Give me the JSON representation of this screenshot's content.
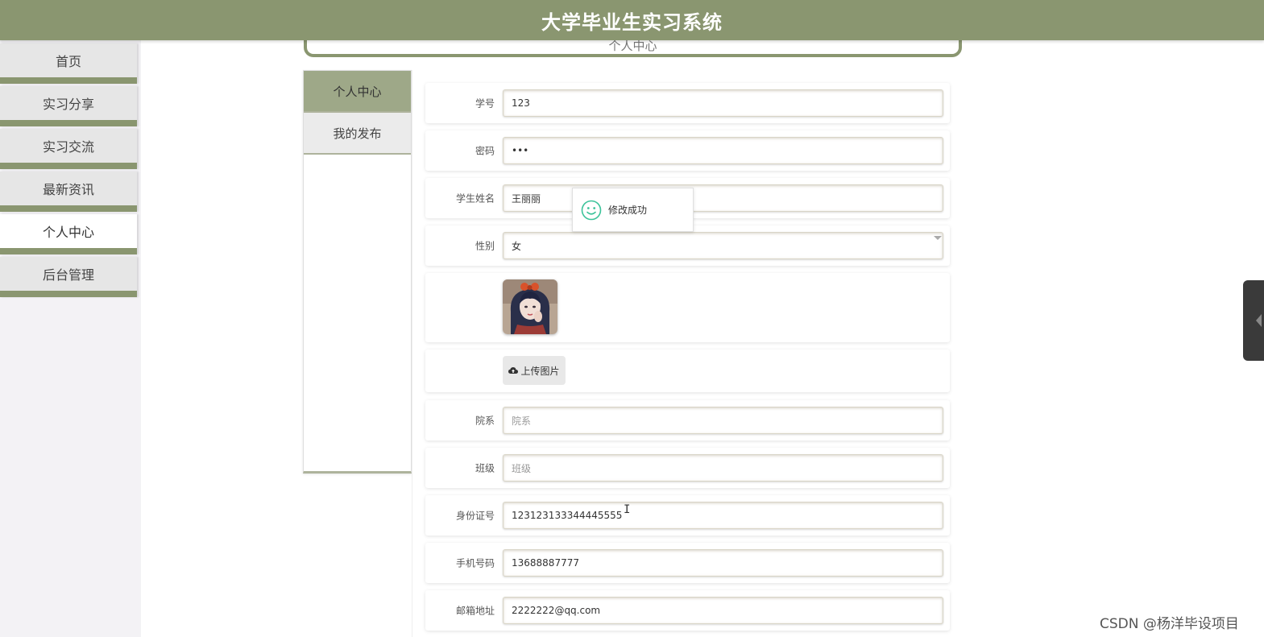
{
  "header": {
    "title": "大学毕业生实习系统"
  },
  "sidebar": {
    "items": [
      {
        "label": "首页"
      },
      {
        "label": "实习分享"
      },
      {
        "label": "实习交流"
      },
      {
        "label": "最新资讯"
      },
      {
        "label": "个人中心",
        "active": true
      },
      {
        "label": "后台管理"
      }
    ]
  },
  "breadcrumb": {
    "label": "个人中心"
  },
  "subnav": {
    "items": [
      {
        "label": "个人中心",
        "active": true
      },
      {
        "label": "我的发布"
      }
    ]
  },
  "form": {
    "student_id": {
      "label": "学号",
      "value": "123"
    },
    "password": {
      "label": "密码",
      "value": "•••"
    },
    "name": {
      "label": "学生姓名",
      "value": "王丽丽"
    },
    "gender": {
      "label": "性别",
      "value": "女"
    },
    "upload": {
      "label": "上传图片",
      "icon": "cloud-upload-icon"
    },
    "department": {
      "label": "院系",
      "placeholder": "院系"
    },
    "class": {
      "label": "班级",
      "placeholder": "班级"
    },
    "id_card": {
      "label": "身份证号",
      "value": "123123133344445555"
    },
    "phone": {
      "label": "手机号码",
      "value": "13688887777"
    },
    "email": {
      "label": "邮箱地址",
      "value": "2222222@qq.com"
    }
  },
  "toast": {
    "message": "修改成功",
    "icon": "smile-icon"
  },
  "watermark": "CSDN @杨洋毕设项目",
  "colors": {
    "accent": "#8a9670",
    "subnav_active": "#9ea888",
    "toast_icon": "#3cc39a"
  }
}
